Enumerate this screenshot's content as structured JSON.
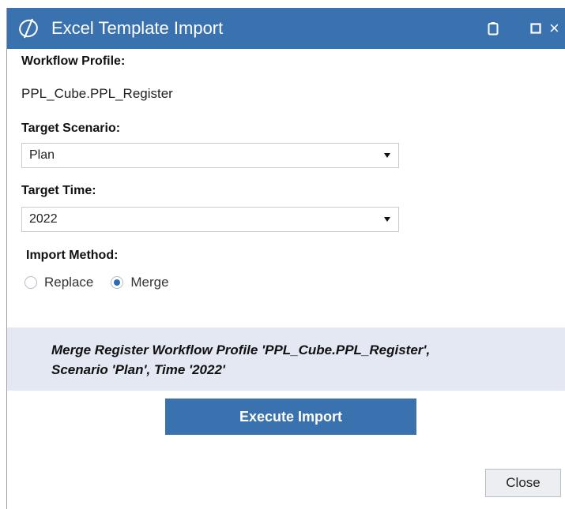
{
  "window": {
    "title": "Excel Template Import",
    "logo_icon": "onestream-logo-icon",
    "titlebar_color": "#3a72b0",
    "buttons": [
      "clipboard-icon",
      "maximize-icon",
      "close-icon"
    ],
    "close_glyph": "×"
  },
  "form": {
    "workflow_profile_label": "Workflow Profile:",
    "workflow_profile_value": "PPL_Cube.PPL_Register",
    "target_scenario_label": "Target Scenario:",
    "target_scenario_value": "Plan",
    "target_time_label": "Target Time:",
    "target_time_value": "2022",
    "import_method_label": "Import Method:",
    "import_method_options": [
      {
        "label": "Replace",
        "checked": false
      },
      {
        "label": "Merge",
        "checked": true
      }
    ]
  },
  "message": {
    "line1": "Merge Register Workflow Profile 'PPL_Cube.PPL_Register',",
    "line2": "Scenario 'Plan', Time '2022'",
    "background": "#e3e8f2"
  },
  "actions": {
    "execute_label": "Execute Import",
    "close_label": "Close",
    "accent": "#3a72b0"
  }
}
